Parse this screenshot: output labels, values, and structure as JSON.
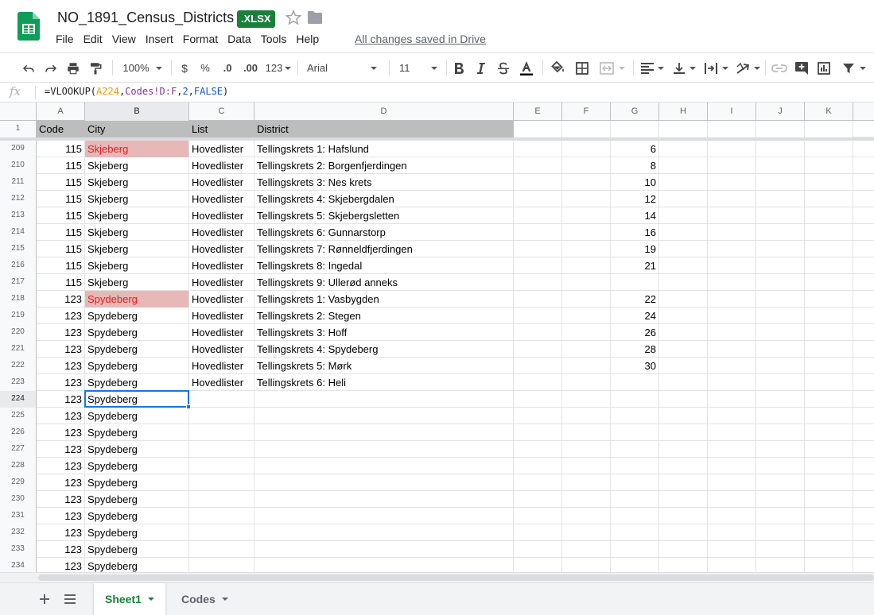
{
  "app": {
    "title": "NO_1891_Census_Districts",
    "format_badge": ".XLSX",
    "save_status": "All changes saved in Drive",
    "brand_color": "#188038"
  },
  "menu": [
    "File",
    "Edit",
    "View",
    "Insert",
    "Format",
    "Data",
    "Tools",
    "Help"
  ],
  "toolbar": {
    "zoom": "100%",
    "currency": "$",
    "percent": "%",
    "decrease_decimal": ".0",
    "increase_decimal": ".00",
    "more_formats": "123",
    "font": "Arial",
    "font_size": "11"
  },
  "formula": {
    "fx": "fx",
    "parts": [
      "=VLOOKUP(",
      "A224",
      ",",
      "Codes!D:F",
      ",",
      "2",
      ",",
      "FALSE",
      ")"
    ]
  },
  "columns": [
    "A",
    "B",
    "C",
    "D",
    "E",
    "F",
    "G",
    "H",
    "I",
    "J",
    "K"
  ],
  "selected_column": "B",
  "header_row": {
    "num": "1",
    "cells": [
      "Code",
      "City",
      "List",
      "District"
    ]
  },
  "rows": [
    {
      "num": "209",
      "code": "115",
      "city": "Skjeberg",
      "list": "Hovedlister",
      "district": "Tellingskrets 1: Hafslund",
      "g": "6",
      "highlight": true
    },
    {
      "num": "210",
      "code": "115",
      "city": "Skjeberg",
      "list": "Hovedlister",
      "district": "Tellingskrets 2: Borgenfjerdingen",
      "g": "8"
    },
    {
      "num": "211",
      "code": "115",
      "city": "Skjeberg",
      "list": "Hovedlister",
      "district": "Tellingskrets 3: Nes krets",
      "g": "10"
    },
    {
      "num": "212",
      "code": "115",
      "city": "Skjeberg",
      "list": "Hovedlister",
      "district": "Tellingskrets 4: Skjebergdalen",
      "g": "12"
    },
    {
      "num": "213",
      "code": "115",
      "city": "Skjeberg",
      "list": "Hovedlister",
      "district": "Tellingskrets 5: Skjebergsletten",
      "g": "14"
    },
    {
      "num": "214",
      "code": "115",
      "city": "Skjeberg",
      "list": "Hovedlister",
      "district": "Tellingskrets 6: Gunnarstorp",
      "g": "16"
    },
    {
      "num": "215",
      "code": "115",
      "city": "Skjeberg",
      "list": "Hovedlister",
      "district": "Tellingskrets 7: Rønneldfjerdingen",
      "g": "19"
    },
    {
      "num": "216",
      "code": "115",
      "city": "Skjeberg",
      "list": "Hovedlister",
      "district": "Tellingskrets 8: Ingedal",
      "g": "21"
    },
    {
      "num": "217",
      "code": "115",
      "city": "Skjeberg",
      "list": "Hovedlister",
      "district": "Tellingskrets 9: Ullerød anneks",
      "g": ""
    },
    {
      "num": "218",
      "code": "123",
      "city": "Spydeberg",
      "list": "Hovedlister",
      "district": "Tellingskrets 1: Vasbygden",
      "g": "22",
      "highlight": true
    },
    {
      "num": "219",
      "code": "123",
      "city": "Spydeberg",
      "list": "Hovedlister",
      "district": "Tellingskrets 2: Stegen",
      "g": "24"
    },
    {
      "num": "220",
      "code": "123",
      "city": "Spydeberg",
      "list": "Hovedlister",
      "district": "Tellingskrets 3: Hoff",
      "g": "26"
    },
    {
      "num": "221",
      "code": "123",
      "city": "Spydeberg",
      "list": "Hovedlister",
      "district": "Tellingskrets 4: Spydeberg",
      "g": "28"
    },
    {
      "num": "222",
      "code": "123",
      "city": "Spydeberg",
      "list": "Hovedlister",
      "district": "Tellingskrets 5: Mørk",
      "g": "30"
    },
    {
      "num": "223",
      "code": "123",
      "city": "Spydeberg",
      "list": "Hovedlister",
      "district": "Tellingskrets 6: Heli",
      "g": ""
    },
    {
      "num": "224",
      "code": "123",
      "city": "Spydeberg",
      "list": "",
      "district": "",
      "g": "",
      "active": true
    },
    {
      "num": "225",
      "code": "123",
      "city": "Spydeberg",
      "list": "",
      "district": "",
      "g": ""
    },
    {
      "num": "226",
      "code": "123",
      "city": "Spydeberg",
      "list": "",
      "district": "",
      "g": ""
    },
    {
      "num": "227",
      "code": "123",
      "city": "Spydeberg",
      "list": "",
      "district": "",
      "g": ""
    },
    {
      "num": "228",
      "code": "123",
      "city": "Spydeberg",
      "list": "",
      "district": "",
      "g": ""
    },
    {
      "num": "229",
      "code": "123",
      "city": "Spydeberg",
      "list": "",
      "district": "",
      "g": ""
    },
    {
      "num": "230",
      "code": "123",
      "city": "Spydeberg",
      "list": "",
      "district": "",
      "g": ""
    },
    {
      "num": "231",
      "code": "123",
      "city": "Spydeberg",
      "list": "",
      "district": "",
      "g": ""
    },
    {
      "num": "232",
      "code": "123",
      "city": "Spydeberg",
      "list": "",
      "district": "",
      "g": ""
    },
    {
      "num": "233",
      "code": "123",
      "city": "Spydeberg",
      "list": "",
      "district": "",
      "g": ""
    },
    {
      "num": "234",
      "code": "123",
      "city": "Spydeberg",
      "list": "",
      "district": "",
      "g": ""
    }
  ],
  "sheets": [
    {
      "label": "Sheet1",
      "active": true
    },
    {
      "label": "Codes",
      "active": false
    }
  ],
  "colors": {
    "highlight_fill": "#e6b8b7",
    "highlight_text": "#e02020",
    "selection": "#1a73e8",
    "header_fill": "#bdbdbd"
  }
}
